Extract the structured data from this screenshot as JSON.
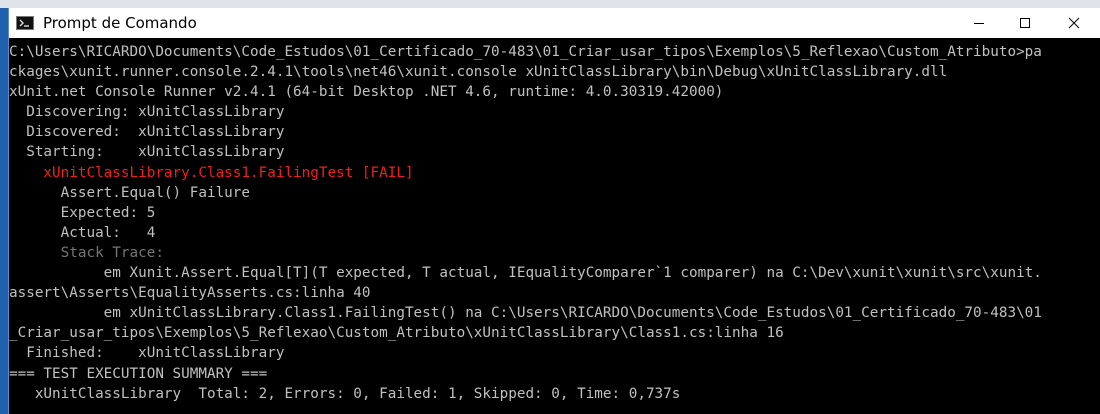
{
  "window": {
    "title": "Prompt de Comando",
    "minimize_icon": "minimize-icon",
    "maximize_icon": "maximize-icon",
    "close_icon": "close-icon"
  },
  "console": {
    "lines": [
      {
        "text": "C:\\Users\\RICARDO\\Documents\\Code_Estudos\\01_Certificado_70-483\\01_Criar_usar_tipos\\Exemplos\\5_Reflexao\\Custom_Atributo>pa",
        "style": "normal"
      },
      {
        "text": "ckages\\xunit.runner.console.2.4.1\\tools\\net46\\xunit.console xUnitClassLibrary\\bin\\Debug\\xUnitClassLibrary.dll",
        "style": "normal"
      },
      {
        "text": "xUnit.net Console Runner v2.4.1 (64-bit Desktop .NET 4.6, runtime: 4.0.30319.42000)",
        "style": "normal"
      },
      {
        "text": "  Discovering: xUnitClassLibrary",
        "style": "normal"
      },
      {
        "text": "  Discovered:  xUnitClassLibrary",
        "style": "normal"
      },
      {
        "text": "  Starting:    xUnitClassLibrary",
        "style": "normal"
      },
      {
        "text": "    xUnitClassLibrary.Class1.FailingTest [FAIL]",
        "style": "red"
      },
      {
        "text": "      Assert.Equal() Failure",
        "style": "normal"
      },
      {
        "text": "      Expected: 5",
        "style": "normal"
      },
      {
        "text": "      Actual:   4",
        "style": "normal"
      },
      {
        "text": "      Stack Trace:",
        "style": "gray"
      },
      {
        "text": "           em Xunit.Assert.Equal[T](T expected, T actual, IEqualityComparer`1 comparer) na C:\\Dev\\xunit\\xunit\\src\\xunit.",
        "style": "normal"
      },
      {
        "text": "assert\\Asserts\\EqualityAsserts.cs:linha 40",
        "style": "normal"
      },
      {
        "text": "           em xUnitClassLibrary.Class1.FailingTest() na C:\\Users\\RICARDO\\Documents\\Code_Estudos\\01_Certificado_70-483\\01",
        "style": "normal"
      },
      {
        "text": "_Criar_usar_tipos\\Exemplos\\5_Reflexao\\Custom_Atributo\\xUnitClassLibrary\\Class1.cs:linha 16",
        "style": "normal"
      },
      {
        "text": "  Finished:    xUnitClassLibrary",
        "style": "normal"
      },
      {
        "text": "=== TEST EXECUTION SUMMARY ===",
        "style": "normal"
      },
      {
        "text": "   xUnitClassLibrary  Total: 2, Errors: 0, Failed: 1, Skipped: 0, Time: 0,737s",
        "style": "normal"
      }
    ]
  },
  "colors": {
    "console_background": "#000000",
    "console_text": "#c0c0c0",
    "error_text": "#f21e1e",
    "muted_text": "#767676",
    "titlebar": "#ffffff"
  }
}
